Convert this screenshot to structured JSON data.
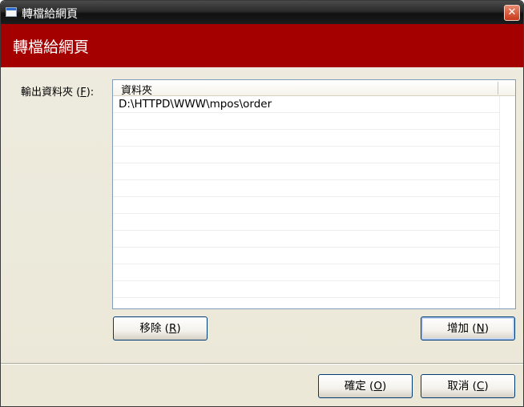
{
  "window": {
    "title": "轉檔給網頁",
    "close_symbol": "✕",
    "app_icon": "window-icon"
  },
  "banner": {
    "title": "轉檔給網頁"
  },
  "output": {
    "label_pre": "輸出資料夾 (",
    "label_key": "F",
    "label_post": "):"
  },
  "folder_list": {
    "column_header": "資料夾",
    "items": [
      "D:\\HTTPD\\WWW\\mpos\\order"
    ]
  },
  "buttons": {
    "remove": {
      "pre": "移除 (",
      "key": "R",
      "post": ")"
    },
    "add": {
      "pre": "增加 (",
      "key": "N",
      "post": ")"
    },
    "ok": {
      "pre": "確定 (",
      "key": "O",
      "post": ")"
    },
    "cancel": {
      "pre": "取消 (",
      "key": "C",
      "post": ")"
    }
  },
  "colors": {
    "banner": "#a50000",
    "titlebar": "#1c1c1c",
    "dialog_bg": "#ece9d8",
    "button_border": "#003c74"
  }
}
